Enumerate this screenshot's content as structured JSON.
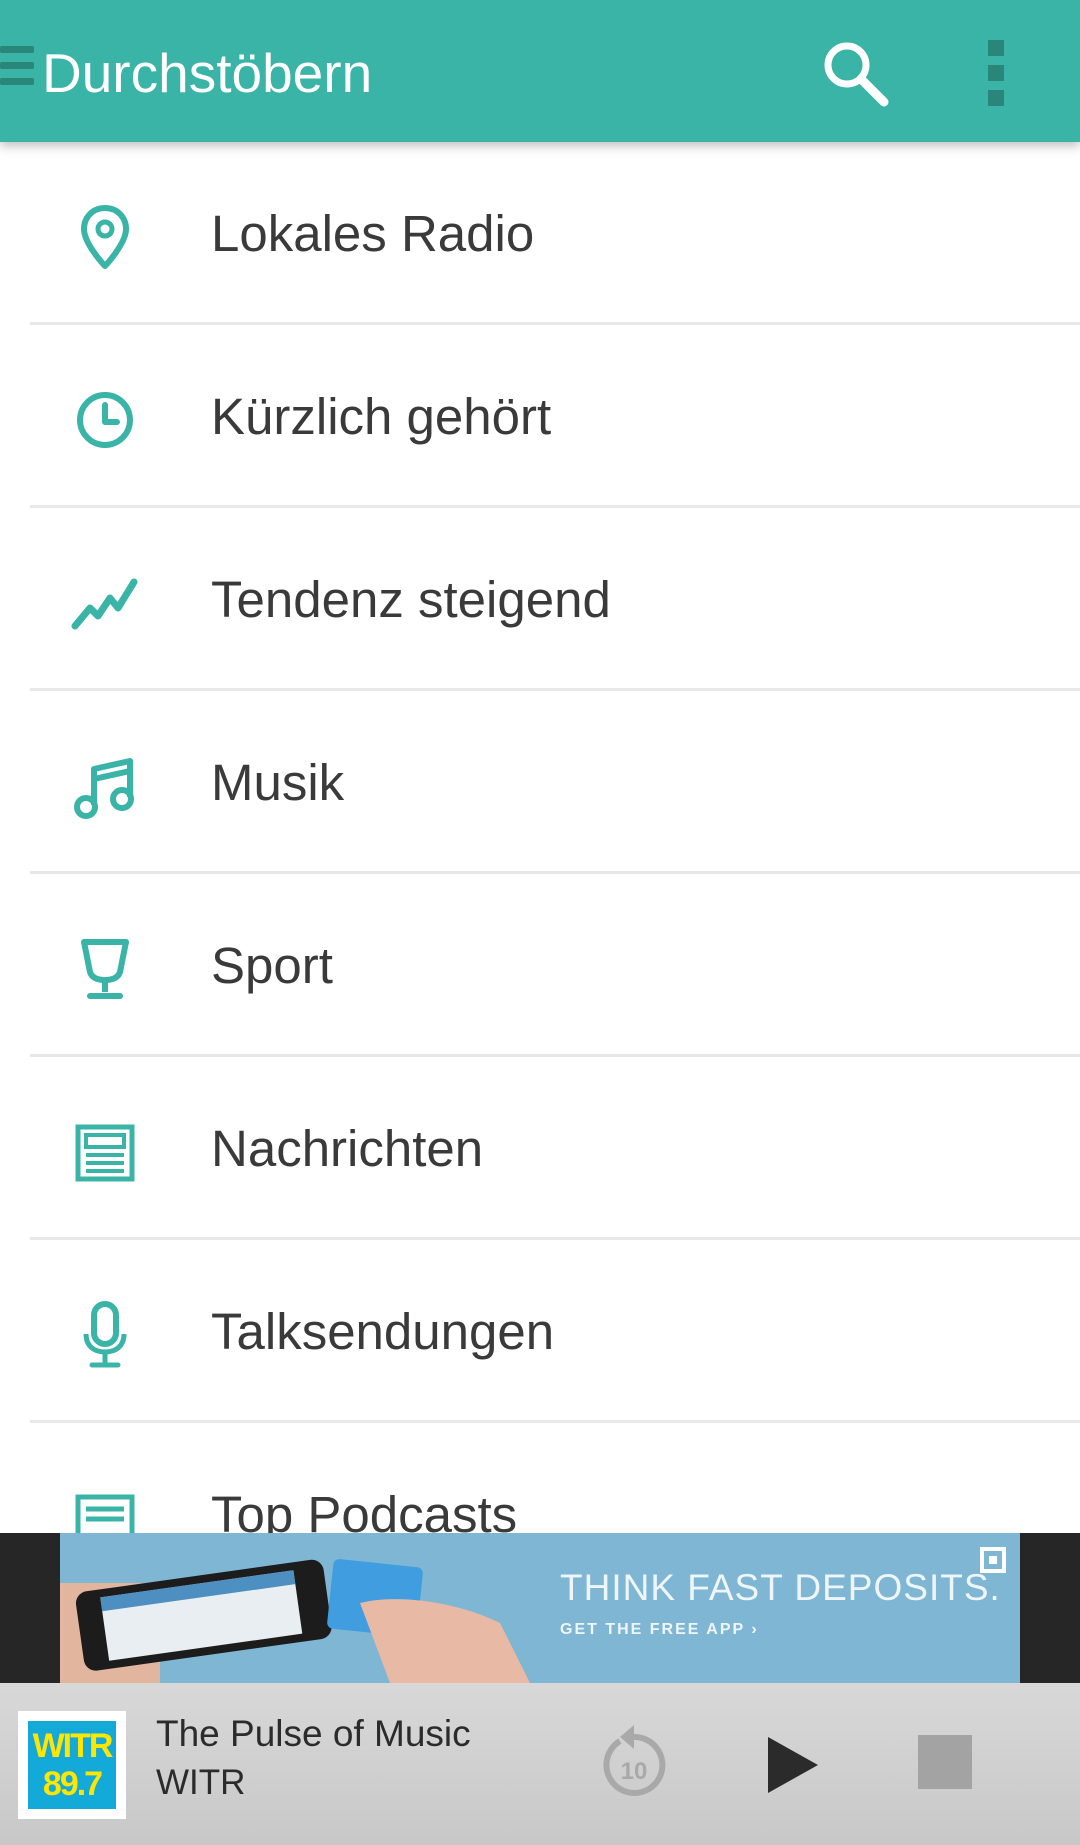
{
  "appbar": {
    "title": "Durchstöbern",
    "icons": [
      "menu-icon",
      "search-icon",
      "more-vert-icon"
    ]
  },
  "colors": {
    "primary": "#39b4a6",
    "primary_dark": "#2a857b",
    "text": "#3a3a3a",
    "divider": "#e8e8e8"
  },
  "browse": {
    "items": [
      {
        "label": "Lokales Radio",
        "icon": "location-pin-icon"
      },
      {
        "label": "Kürzlich gehört",
        "icon": "clock-icon"
      },
      {
        "label": "Tendenz steigend",
        "icon": "trending-icon"
      },
      {
        "label": "Musik",
        "icon": "music-note-icon"
      },
      {
        "label": "Sport",
        "icon": "trophy-icon"
      },
      {
        "label": "Nachrichten",
        "icon": "newspaper-icon"
      },
      {
        "label": "Talksendungen",
        "icon": "microphone-icon"
      },
      {
        "label": "Top Podcasts",
        "icon": "podcast-icon"
      }
    ]
  },
  "ad": {
    "headline": "THINK FAST DEPOSITS.",
    "subline": "GET THE FREE APP ›"
  },
  "player": {
    "logo_line1": "WITR",
    "logo_line2": "89.7",
    "title": "The Pulse of Music",
    "station": "WITR",
    "rewind_label": "10"
  }
}
